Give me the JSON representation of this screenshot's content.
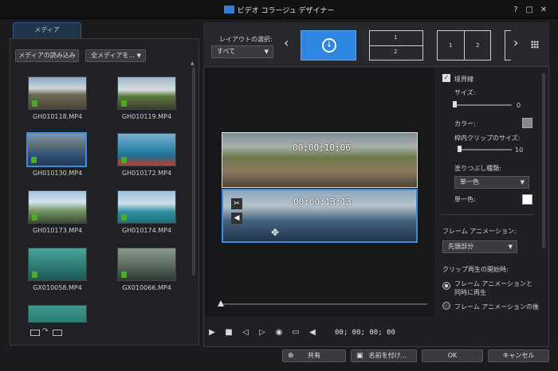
{
  "window": {
    "title": "ビデオ コラージュ デザイナー",
    "help": "?",
    "maximize": "□",
    "close": "✕"
  },
  "left": {
    "tab": "メディア",
    "import_button": "メディアの読み込み",
    "filter_select": "全メディアを...",
    "items": [
      {
        "label": "GH010118.MP4"
      },
      {
        "label": "GH010119.MP4"
      },
      {
        "label": "GH010130.MP4"
      },
      {
        "label": "GH010172.MP4"
      },
      {
        "label": "GH010173.MP4"
      },
      {
        "label": "GH010174.MP4"
      },
      {
        "label": "GX010058.MP4"
      },
      {
        "label": "GX010066.MP4"
      }
    ]
  },
  "layout": {
    "label": "レイアウトの選択:",
    "select": "すべて",
    "opt1_top": "1",
    "opt1_bottom": "2",
    "opt2_left": "1",
    "opt2_right": "2"
  },
  "preview": {
    "tc_top": "00;00;10;06",
    "tc_bottom": "00;00;13;13",
    "time": "00; 00; 00; 00"
  },
  "settings": {
    "border_label": "境界線",
    "size_label": "サイズ:",
    "size_value": "0",
    "color_label": "カラー:",
    "inner_label": "枠内クリップのサイズ:",
    "inner_value": "10",
    "fill_label": "塗りつぶし種類:",
    "fill_select": "単一色",
    "single_label": "単一色:",
    "anim_label": "フレーム アニメーション:",
    "anim_select": "先頭部分",
    "start_label": "クリップ再生の開始時:",
    "radio1": "フレーム アニメーションと同時に再生",
    "radio2": "フレーム アニメーションの後"
  },
  "bottom": {
    "share": "共有",
    "save_as": "名前を付け...",
    "ok": "OK",
    "cancel": "キャンセル"
  }
}
